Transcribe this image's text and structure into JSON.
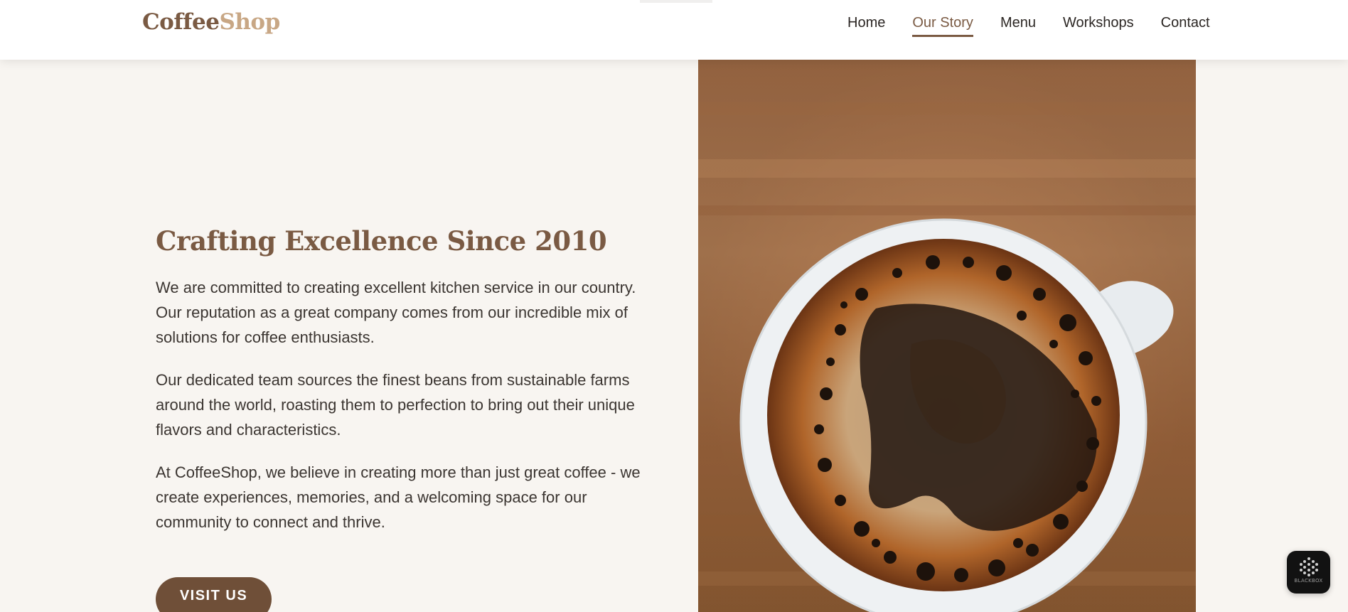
{
  "header": {
    "logo_part1": "Coffee",
    "logo_part2": "Shop",
    "nav": [
      {
        "label": "Home",
        "active": false
      },
      {
        "label": "Our Story",
        "active": true
      },
      {
        "label": "Menu",
        "active": false
      },
      {
        "label": "Workshops",
        "active": false
      },
      {
        "label": "Contact",
        "active": false
      }
    ]
  },
  "story": {
    "heading": "Crafting Excellence Since 2010",
    "paragraphs": [
      "We are committed to creating excellent kitchen service in our country. Our reputation as a great company comes from our incredible mix of solutions for coffee enthusiasts.",
      "Our dedicated team sources the finest beans from sustainable farms around the world, roasting them to perfection to bring out their unique flavors and characteristics.",
      "At CoffeeShop, we believe in creating more than just great coffee - we create experiences, memories, and a welcoming space for our community to connect and thrive."
    ],
    "button_label": "VISIT US"
  },
  "hero": {
    "image_subject": "coffee-cup-on-wooden-table"
  },
  "badge": {
    "text": "BLACKBOX"
  },
  "colors": {
    "brand_brown": "#7a5a43",
    "logo_light": "#c8a785",
    "button_bg": "#6f4f38",
    "page_bg": "#f8f5f1"
  }
}
